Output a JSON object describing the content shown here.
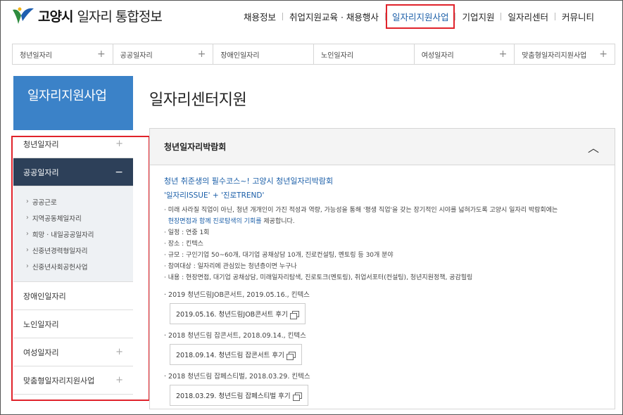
{
  "header": {
    "brand": "고양시",
    "subtitle": "일자리 통합정보",
    "nav": [
      "채용정보",
      "취업지원교육 · 채용행사",
      "일자리지원사업",
      "기업지원",
      "일자리센터",
      "커뮤니티"
    ]
  },
  "category_bar": [
    "청년일자리",
    "공공일자리",
    "장애인일자리",
    "노인일자리",
    "여성일자리",
    "맞춤형일자리지원사업"
  ],
  "sidebar": {
    "title": "일자리지원사업",
    "items": {
      "youth": "청년일자리",
      "public": "공공일자리",
      "public_sub": [
        "공공근로",
        "지역공동체일자리",
        "희망 · 내일공공일자리",
        "신중년경력형일자리",
        "신중년사회공헌사업"
      ],
      "disabled": "장애인일자리",
      "senior": "노인일자리",
      "women": "여성일자리",
      "custom": "맞춤형일자리지원사업"
    }
  },
  "main": {
    "page_title": "일자리센터지원",
    "panel_title": "청년일자리박람회",
    "headline": "청년 취준생의 필수코스~! 고양시 청년일자리박람회",
    "headline2": "'일자리ISSUE' + '진로TREND'",
    "desc_a": "· 미래 사라질 직업이 아닌, 청년 개개인이 가진 적성과 역량, 가능성을 통해 '평생 직업'을 갖는 장기적인 시야를 넓혀가도록 고양시 일자리 박람회에는",
    "desc_b_blue": "현장면접과 함께 진로탐색의 기회를",
    "desc_b_rest": " 제공합니다.",
    "bullets": [
      "· 일정 : 연중 1회",
      "· 장소 : 킨텍스",
      "· 규모 : 구인기업 50~60개, 대기업 공채상담 10개, 진로컨설팅, 멘토링 등 30개 분야",
      "· 참여대상 : 일자리에 관심있는 청년층이면 누구나",
      "· 내용 : 현장면접, 대기업 공채상담, 미래일자리탐색, 진로토크(멘토링), 취업서포터(컨설팅), 청년지원정책, 공감힐링"
    ],
    "events": [
      {
        "title": "· 2019 청년드림JOB콘서트, 2019.05.16., 킨텍스",
        "link": "2019.05.16. 청년드림JOB콘서트 후기"
      },
      {
        "title": "· 2018 청년드림 잡콘서트, 2018.09.14., 킨텍스",
        "link": "2018.09.14. 청년드림 잡콘서트 후기"
      },
      {
        "title": "· 2018 청년드림 잡페스티벌, 2018.03.29. 킨텍스",
        "link": "2018.03.29. 청년드림 잡페스티벌 후기"
      }
    ]
  },
  "colors": {
    "accent": "#3b82c8",
    "active_menu": "#2d4059",
    "highlight_border": "#e0232b",
    "link": "#1a5ea8"
  },
  "icons": {
    "plus": "+",
    "minus": "−",
    "chevron": "︿",
    "dot": "›"
  }
}
